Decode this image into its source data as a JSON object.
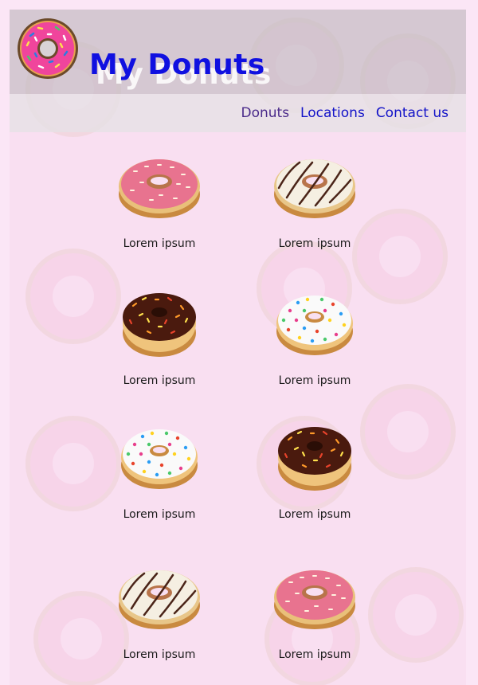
{
  "header": {
    "title": "My Donuts",
    "logo_icon": "pink-sprinkled-donut-icon"
  },
  "nav": {
    "items": [
      {
        "label": "Donuts",
        "active": true
      },
      {
        "label": "Locations",
        "active": false
      },
      {
        "label": "Contact us",
        "active": false
      }
    ]
  },
  "donuts": [
    {
      "label": "Lorem ipsum",
      "variant": "pink-frosted-sprinkles"
    },
    {
      "label": "Lorem ipsum",
      "variant": "white-chocolate-drizzle"
    },
    {
      "label": "Lorem ipsum",
      "variant": "chocolate-rainbow-sprinkles"
    },
    {
      "label": "Lorem ipsum",
      "variant": "white-rainbow-sprinkles"
    },
    {
      "label": "Lorem ipsum",
      "variant": "white-rainbow-sprinkles"
    },
    {
      "label": "Lorem ipsum",
      "variant": "chocolate-rainbow-sprinkles"
    },
    {
      "label": "Lorem ipsum",
      "variant": "white-chocolate-drizzle"
    },
    {
      "label": "Lorem ipsum",
      "variant": "pink-frosted-sprinkles"
    }
  ],
  "colors": {
    "title": "#1010e0",
    "nav_link": "#1212c8",
    "nav_active": "#4a2a8a",
    "page_bg": "#f9dff1"
  }
}
